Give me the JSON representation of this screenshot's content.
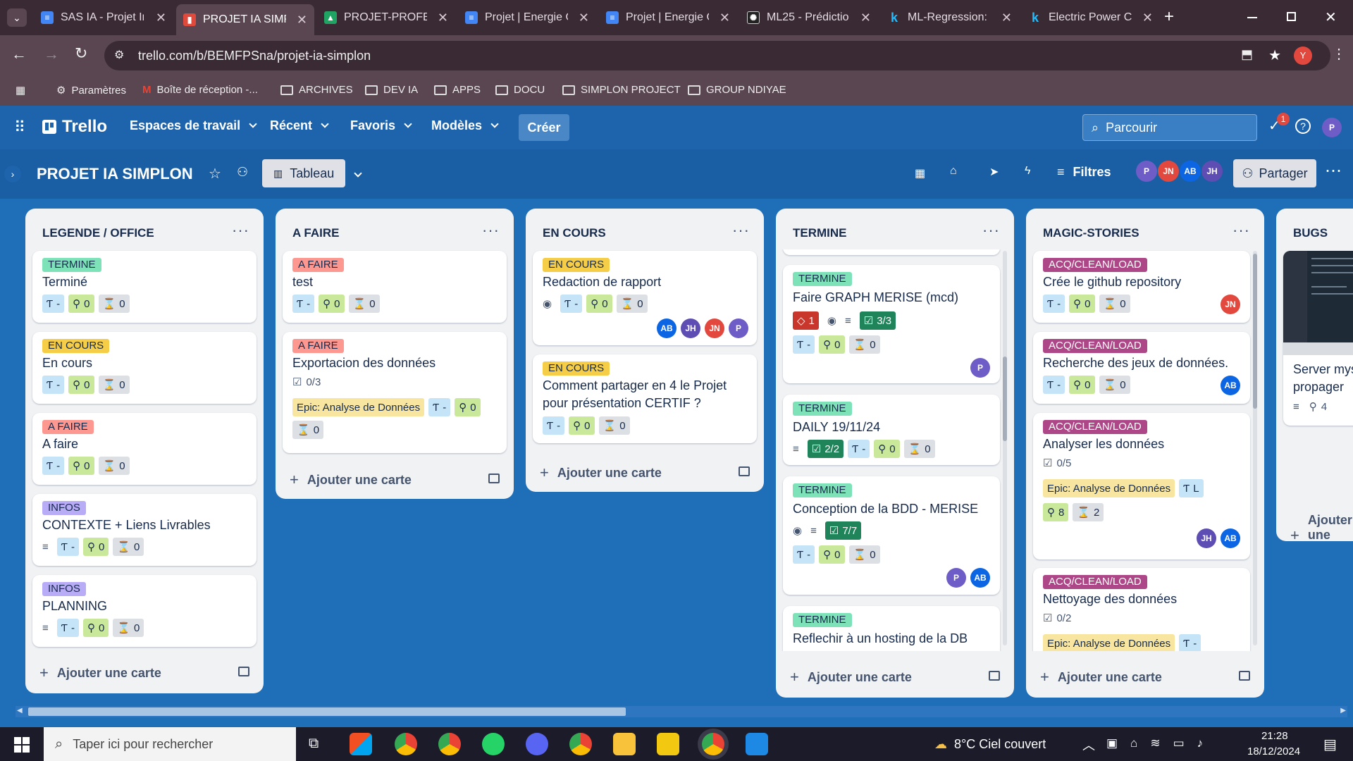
{
  "tabs": [
    {
      "title": "SAS IA - Projet Ir",
      "color": "#4285f4"
    },
    {
      "title": "PROJET IA SIMPL",
      "color": "#e04a3c"
    },
    {
      "title": "PROJET-PROFESS",
      "color": "#1fa463"
    },
    {
      "title": "Projet | Energie C",
      "color": "#4285f4"
    },
    {
      "title": "Projet | Energie C",
      "color": "#4285f4"
    },
    {
      "title": "ML25 - Prédictio",
      "color": "#222222"
    },
    {
      "title": "ML-Regression: l",
      "color": "#20beff"
    },
    {
      "title": "Electric Power Co",
      "color": "#20beff"
    }
  ],
  "browser": {
    "url": "trello.com/b/BEMFPSna/projet-ia-simplon",
    "profile": "Y"
  },
  "bookmarks": [
    "Paramètres",
    "Boîte de réception -...",
    "ARCHIVES",
    "DEV IA",
    "APPS",
    "DOCU",
    "SIMPLON PROJECT",
    "GROUP NDIYAE"
  ],
  "trello": {
    "logo": "Trello",
    "nav": [
      "Espaces de travail",
      "Récent",
      "Favoris",
      "Modèles"
    ],
    "create": "Créer",
    "search_placeholder": "Parcourir",
    "notif_count": "1",
    "user": "P"
  },
  "board": {
    "title": "PROJET IA SIMPLON",
    "view": "Tableau",
    "filters": "Filtres",
    "share": "Partager",
    "members": [
      "P",
      "JN",
      "AB",
      "JH"
    ]
  },
  "add_card": "Ajouter une carte",
  "lists": [
    {
      "title": "LEGENDE / OFFICE",
      "cards": [
        {
          "label": "TERMINE",
          "title": "Terminé",
          "t": "-",
          "p": "0",
          "h": "0"
        },
        {
          "label": "EN COURS",
          "title": "En cours",
          "t": "-",
          "p": "0",
          "h": "0"
        },
        {
          "label": "A FAIRE",
          "title": "A faire",
          "t": "-",
          "p": "0",
          "h": "0"
        },
        {
          "label": "INFOS",
          "title": "CONTEXTE + Liens Livrables",
          "t": "-",
          "p": "0",
          "h": "0"
        },
        {
          "label": "INFOS",
          "title": "PLANNING",
          "t": "-",
          "p": "0",
          "h": "0"
        }
      ]
    },
    {
      "title": "A FAIRE",
      "cards": [
        {
          "label": "A FAIRE",
          "title": "test",
          "t": "-",
          "p": "0",
          "h": "0"
        },
        {
          "label": "A FAIRE",
          "title": "Exportacion des données",
          "check": "0/3",
          "epic": "Epic: Analyse de Données",
          "t": "-",
          "p": "0",
          "h": "0"
        }
      ]
    },
    {
      "title": "EN COURS",
      "cards": [
        {
          "label": "EN COURS",
          "title": "Redaction de rapport",
          "t": "-",
          "p": "0",
          "h": "0",
          "members": [
            "AB",
            "JH",
            "JN",
            "P"
          ]
        },
        {
          "label": "EN COURS",
          "title1": "Comment partager en 4 le Projet",
          "title2": "pour présentation CERTIF ?",
          "t": "-",
          "p": "0",
          "h": "0"
        }
      ]
    },
    {
      "title": "TERMINE",
      "cards": [
        {
          "label": "TERMINE",
          "title": "Faire GRAPH MERISE (mcd)",
          "alert": "1",
          "check": "3/3",
          "t": "-",
          "p": "0",
          "h": "0",
          "members": [
            "P"
          ]
        },
        {
          "label": "TERMINE",
          "title": "DAILY 19/11/24",
          "check": "2/2",
          "t": "-",
          "p": "0",
          "h": "0"
        },
        {
          "label": "TERMINE",
          "title": "Conception de la BDD - MERISE",
          "check": "7/7",
          "t": "-",
          "p": "0",
          "h": "0",
          "members": [
            "P",
            "AB"
          ]
        },
        {
          "label": "TERMINE",
          "title": "Reflechir à un hosting de la DB"
        }
      ]
    },
    {
      "title": "MAGIC-STORIES",
      "cards": [
        {
          "label": "ACQ/CLEAN/LOAD",
          "title": "Crée le github repository",
          "t": "-",
          "p": "0",
          "h": "0",
          "members": [
            "JN"
          ]
        },
        {
          "label": "ACQ/CLEAN/LOAD",
          "title": "Recherche des jeux de données.",
          "t": "-",
          "p": "0",
          "h": "0",
          "members": [
            "AB"
          ]
        },
        {
          "label": "ACQ/CLEAN/LOAD",
          "title": "Analyser les données",
          "check": "0/5",
          "epic": "Epic: Analyse de Données",
          "t": "L",
          "p": "8",
          "h": "2",
          "members": [
            "JH",
            "AB"
          ]
        },
        {
          "label": "ACQ/CLEAN/LOAD",
          "title": "Nettoyage des données",
          "check": "0/2",
          "epic": "Epic: Analyse de Données",
          "t": "-"
        }
      ]
    },
    {
      "title": "BUGS",
      "cards": [
        {
          "title1": "Server mys",
          "title2": "propager",
          "count": "4"
        }
      ]
    }
  ],
  "taskbar": {
    "search": "Taper ici pour rechercher",
    "weather": "8°C  Ciel couvert",
    "time": "21:28",
    "date": "18/12/2024"
  },
  "colors": {
    "termine": "#7ee2b8",
    "encours": "#f5cd47",
    "afaire": "#fd9891",
    "infos": "#b8acf6",
    "acq": "#ae4787",
    "AB": "#0c66e4",
    "JH": "#5e4db2",
    "JN": "#e2483d",
    "P": "#6e5dc6"
  }
}
